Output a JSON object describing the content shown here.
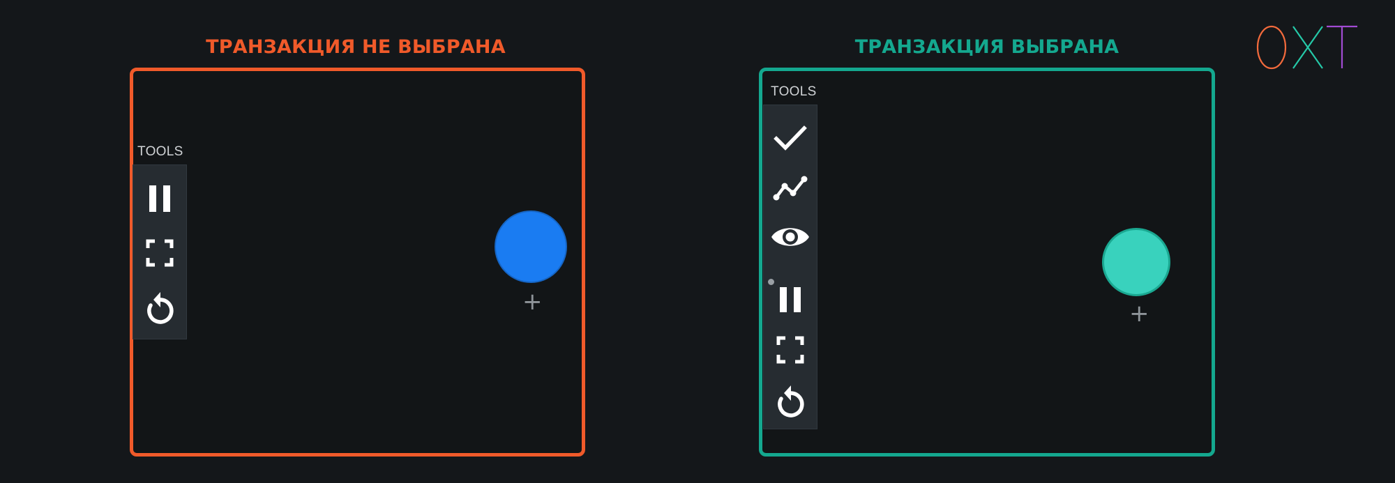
{
  "colors": {
    "background": "#14171a",
    "left_accent": "#f05a2a",
    "right_accent": "#14a88f",
    "left_circle": "#1a7cf2",
    "right_circle": "#39d2bd",
    "logo_o": "#f26a3c",
    "logo_x": "#25c9a8",
    "logo_t": "#a24bd4"
  },
  "left_panel": {
    "title": "ТРАНЗАКЦИЯ НЕ ВЫБРАНА",
    "tools_label": "TOOLS",
    "tools": [
      {
        "icon": "pause-icon"
      },
      {
        "icon": "fullscreen-icon"
      },
      {
        "icon": "reset-icon"
      }
    ],
    "plus": "+"
  },
  "right_panel": {
    "title": "ТРАНЗАКЦИЯ ВЫБРАНА",
    "tools_label": "TOOLS",
    "tools": [
      {
        "icon": "check-icon"
      },
      {
        "icon": "line-chart-icon"
      },
      {
        "icon": "eye-icon"
      },
      {
        "icon": "pause-icon"
      },
      {
        "icon": "fullscreen-icon"
      },
      {
        "icon": "reset-icon"
      }
    ],
    "plus": "+"
  },
  "logo": {
    "letters": [
      "O",
      "X",
      "T"
    ]
  }
}
